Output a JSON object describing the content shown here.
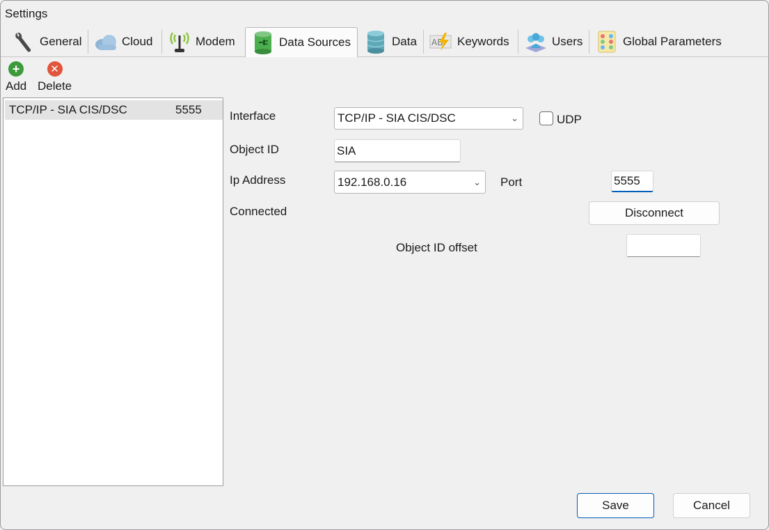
{
  "window": {
    "title": "Settings"
  },
  "tabs": [
    {
      "label": "General",
      "icon": "wrench-icon"
    },
    {
      "label": "Cloud",
      "icon": "cloud-icon"
    },
    {
      "label": "Modem",
      "icon": "antenna-icon"
    },
    {
      "label": "Data Sources",
      "icon": "database-plug-icon",
      "active": true
    },
    {
      "label": "Data",
      "icon": "database-icon"
    },
    {
      "label": "Keywords",
      "icon": "abc-lightning-icon"
    },
    {
      "label": "Users",
      "icon": "users-icon"
    },
    {
      "label": "Global Parameters",
      "icon": "grid-parameters-icon"
    }
  ],
  "toolbar": {
    "add_label": "Add",
    "delete_label": "Delete",
    "add_color": "#3c9a3c",
    "delete_color": "#e0553b"
  },
  "sources": [
    {
      "name": "TCP/IP - SIA CIS/DSC",
      "port": "5555"
    }
  ],
  "form": {
    "interface_label": "Interface",
    "interface_value": "TCP/IP - SIA CIS/DSC",
    "udp_label": "UDP",
    "udp_checked": false,
    "object_id_label": "Object ID",
    "object_id_value": "SIA",
    "ip_label": "Ip Address",
    "ip_value": "192.168.0.16",
    "port_label": "Port",
    "port_value": "5555",
    "status_text": "Connected",
    "disconnect_label": "Disconnect",
    "offset_label": "Object ID offset",
    "offset_value": ""
  },
  "footer": {
    "save_label": "Save",
    "cancel_label": "Cancel"
  },
  "colors": {
    "accent": "#005fb8",
    "selection": "#e3e3e3"
  }
}
